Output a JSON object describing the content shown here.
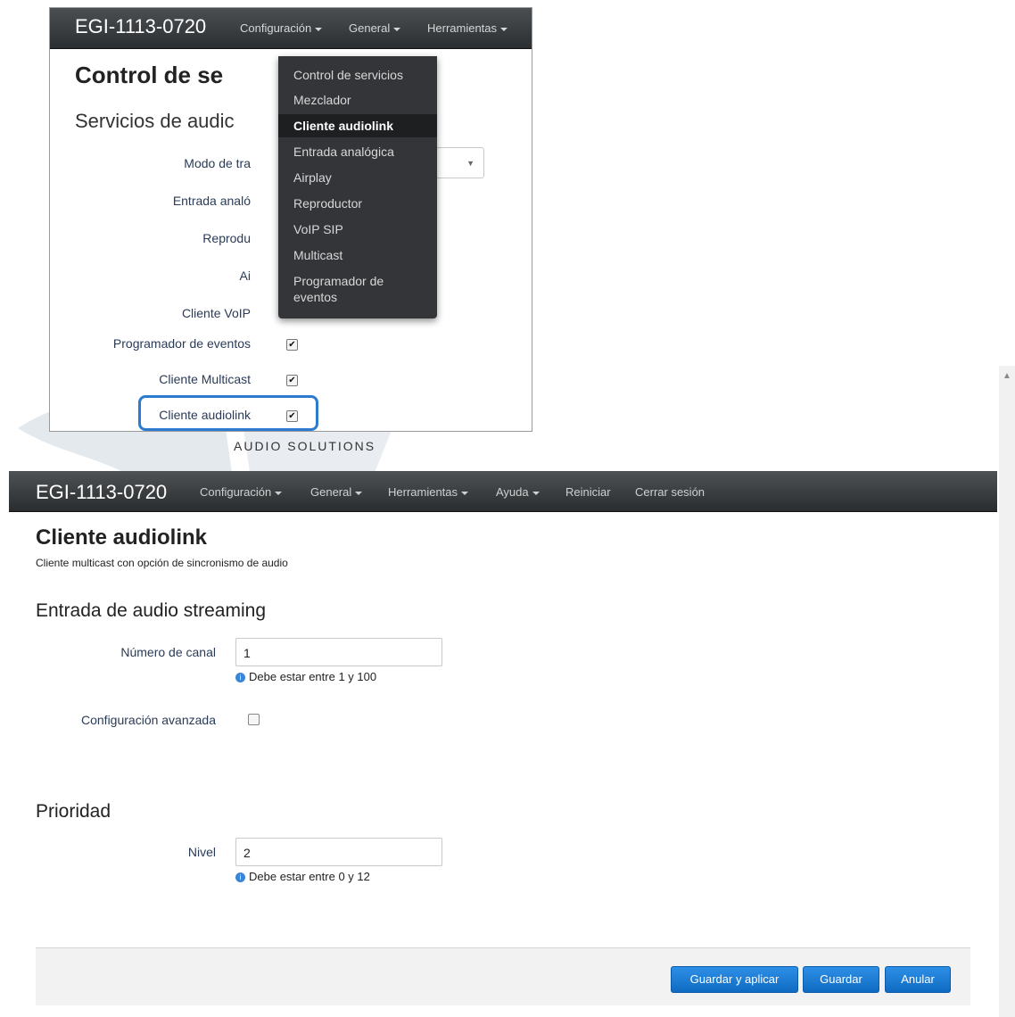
{
  "inset": {
    "brand": "EGI-1113-0720",
    "nav": {
      "configuracion": "Configuración",
      "general": "General",
      "herramientas": "Herramientas"
    },
    "title": "Control de se",
    "subtitle": "Servicios de audic",
    "rows": [
      {
        "label": "Modo de tra"
      },
      {
        "label": "Entrada analó"
      },
      {
        "label": "Reprodu"
      },
      {
        "label": "Ai"
      },
      {
        "label": "Cliente VoIP"
      },
      {
        "label": "Programador de eventos",
        "checked": true
      },
      {
        "label": "Cliente Multicast",
        "checked": true
      },
      {
        "label": "Cliente audiolink",
        "checked": true
      }
    ],
    "dropdown": [
      "Control de servicios",
      "Mezclador",
      "Cliente audiolink",
      "Entrada analógica",
      "Airplay",
      "Reproductor",
      "VoIP SIP",
      "Multicast",
      "Programador de",
      "eventos"
    ],
    "dropdown_active": "Cliente audiolink"
  },
  "watermark": "AUDIO SOLUTIONS",
  "app": {
    "brand": "EGI-1113-0720",
    "nav": {
      "configuracion": "Configuración",
      "general": "General",
      "herramientas": "Herramientas",
      "ayuda": "Ayuda",
      "reiniciar": "Reiniciar",
      "cerrar": "Cerrar sesión"
    },
    "title": "Cliente audiolink",
    "description": "Cliente multicast con opción de sincronismo de audio",
    "section1": "Entrada de audio streaming",
    "channel_label": "Número de canal",
    "channel_value": "1",
    "channel_hint": "Debe estar entre 1 y 100",
    "advanced_label": "Configuración avanzada",
    "advanced_checked": false,
    "section2": "Prioridad",
    "level_label": "Nivel",
    "level_value": "2",
    "level_hint": "Debe estar entre 0 y 12",
    "buttons": {
      "save_apply": "Guardar y aplicar",
      "save": "Guardar",
      "cancel": "Anular"
    }
  },
  "colors": {
    "accent": "#2c7bd1",
    "button": "#1a7bd6",
    "navbar": "#3a3d40"
  }
}
